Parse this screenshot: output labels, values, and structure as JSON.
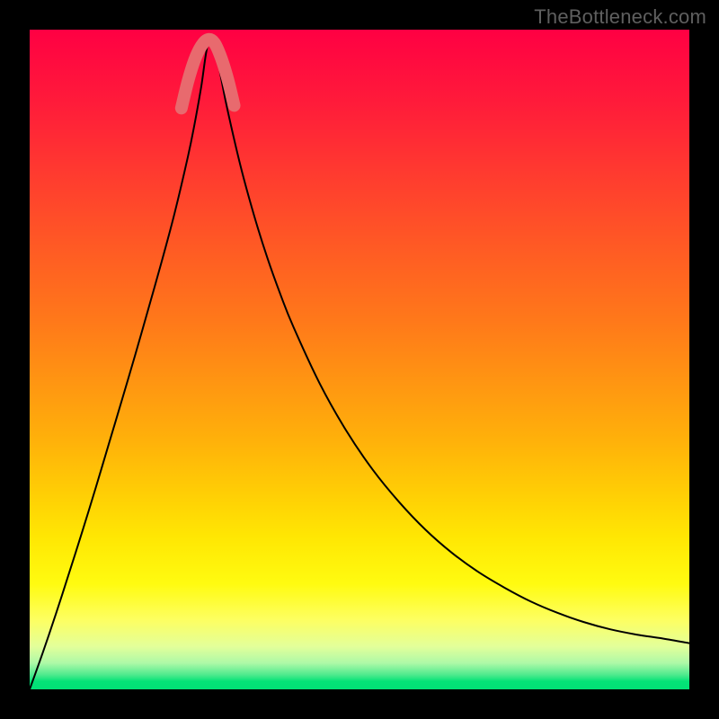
{
  "watermark": {
    "text": "TheBottleneck.com"
  },
  "colors": {
    "frame": "#000000",
    "watermark": "#5f5f5f",
    "curve": "#000000",
    "marker": "#e86a6e",
    "gradient_stops": [
      {
        "offset": 0.0,
        "color": "#ff0043"
      },
      {
        "offset": 0.11,
        "color": "#ff1b3a"
      },
      {
        "offset": 0.22,
        "color": "#ff3b2f"
      },
      {
        "offset": 0.33,
        "color": "#ff5a24"
      },
      {
        "offset": 0.44,
        "color": "#ff781a"
      },
      {
        "offset": 0.53,
        "color": "#ff9412"
      },
      {
        "offset": 0.62,
        "color": "#ffb00a"
      },
      {
        "offset": 0.7,
        "color": "#ffcd05"
      },
      {
        "offset": 0.77,
        "color": "#ffe703"
      },
      {
        "offset": 0.84,
        "color": "#fffb10"
      },
      {
        "offset": 0.895,
        "color": "#fdff62"
      },
      {
        "offset": 0.935,
        "color": "#e3ff9a"
      },
      {
        "offset": 0.96,
        "color": "#aef9a7"
      },
      {
        "offset": 0.978,
        "color": "#4eea8d"
      },
      {
        "offset": 0.988,
        "color": "#04e277"
      },
      {
        "offset": 1.0,
        "color": "#02e076"
      }
    ]
  },
  "chart_data": {
    "type": "line",
    "title": "",
    "xlabel": "",
    "ylabel": "",
    "x_range": [
      0,
      100
    ],
    "y_range": [
      0,
      1
    ],
    "x_optimum": 27,
    "series": [
      {
        "name": "bottleneck_curve",
        "x": [
          0,
          2,
          4,
          6,
          8,
          10,
          12,
          14,
          16,
          18,
          20,
          22,
          24,
          25,
          26,
          27,
          28,
          29,
          30,
          32,
          34,
          36,
          38,
          40,
          44,
          48,
          52,
          56,
          60,
          64,
          68,
          72,
          76,
          80,
          84,
          88,
          92,
          96,
          100
        ],
        "y": [
          1.0,
          0.944,
          0.885,
          0.823,
          0.76,
          0.695,
          0.628,
          0.561,
          0.493,
          0.423,
          0.352,
          0.277,
          0.192,
          0.143,
          0.087,
          0.023,
          0.02,
          0.072,
          0.122,
          0.208,
          0.281,
          0.345,
          0.401,
          0.451,
          0.537,
          0.608,
          0.667,
          0.716,
          0.758,
          0.793,
          0.822,
          0.846,
          0.867,
          0.884,
          0.898,
          0.909,
          0.917,
          0.923,
          0.93
        ]
      }
    ],
    "marker": {
      "name": "low_bottleneck_region",
      "x": [
        23,
        24,
        25,
        26,
        27,
        28,
        29,
        30,
        31
      ],
      "y": [
        0.119,
        0.078,
        0.046,
        0.025,
        0.015,
        0.02,
        0.042,
        0.074,
        0.115
      ]
    }
  }
}
